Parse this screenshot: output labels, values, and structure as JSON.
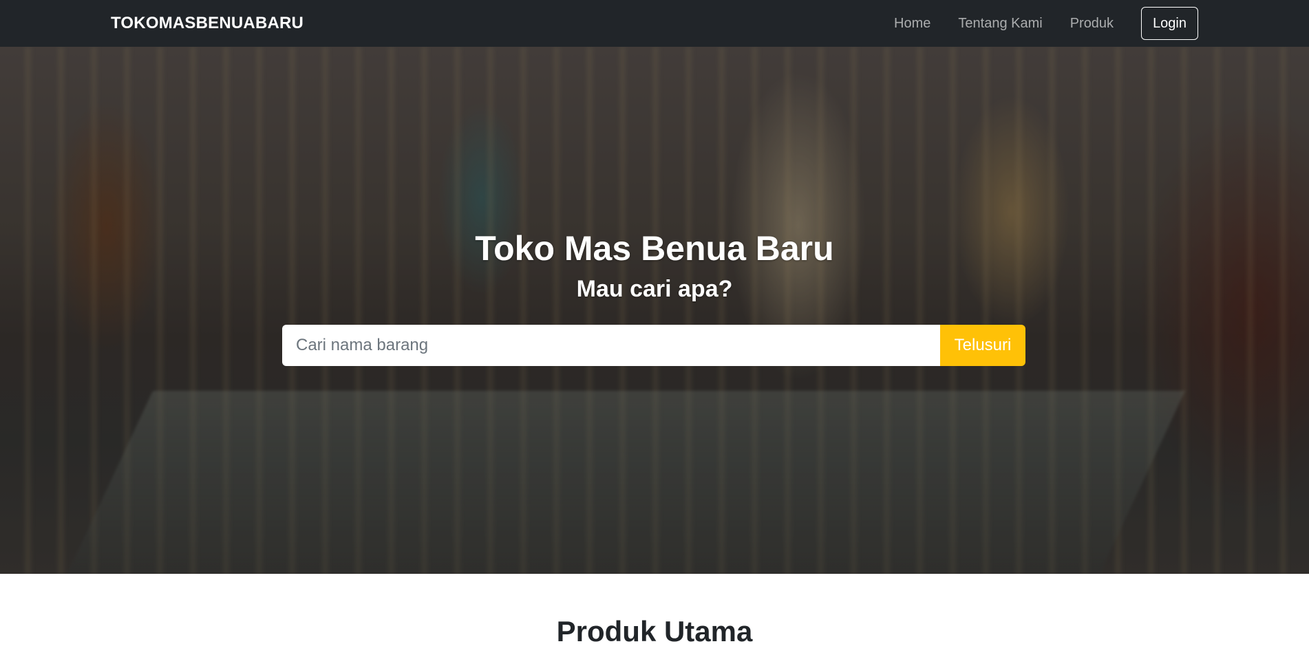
{
  "navbar": {
    "brand": "TOKOMASBENUABARU",
    "links": [
      {
        "label": "Home"
      },
      {
        "label": "Tentang Kami"
      },
      {
        "label": "Produk"
      }
    ],
    "login_label": "Login"
  },
  "hero": {
    "title": "Toko Mas Benua Baru",
    "subtitle": "Mau cari apa?",
    "search": {
      "placeholder": "Cari nama barang",
      "value": "",
      "button_label": "Telusuri"
    }
  },
  "products": {
    "section_title": "Produk Utama"
  },
  "colors": {
    "navbar_bg": "#212529",
    "accent": "#ffc107"
  }
}
